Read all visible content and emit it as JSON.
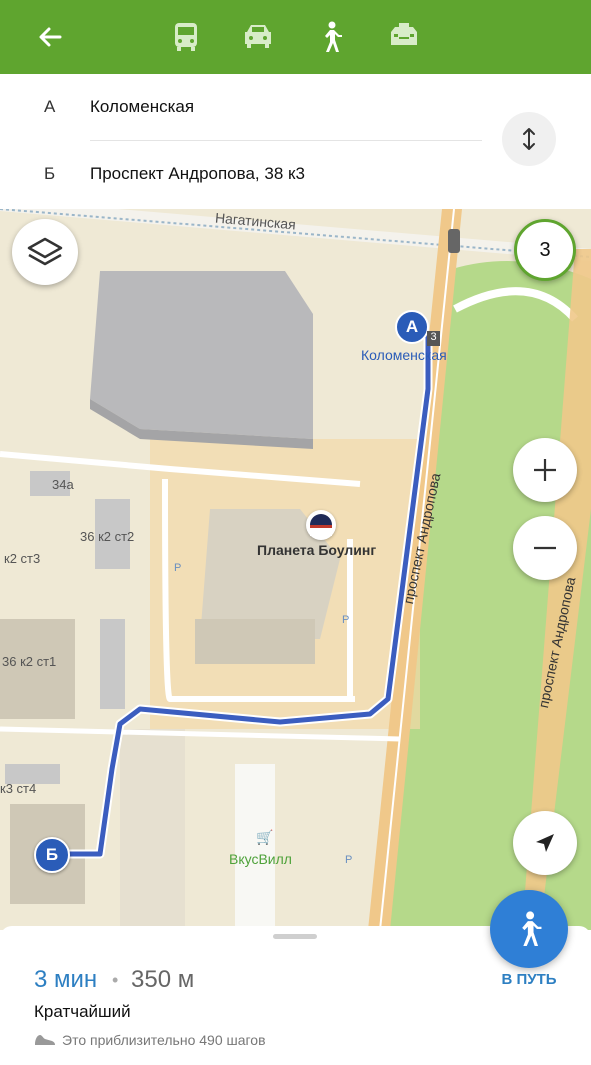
{
  "topbar": {
    "icons": [
      "back-arrow-icon",
      "bus-icon",
      "car-icon",
      "walking-icon",
      "taxi-icon"
    ],
    "color": "#5fa52f"
  },
  "route": {
    "from_letter": "А",
    "from_value": "Коломенская",
    "to_letter": "Б",
    "to_value": "Проспект Андропова, 38 к3"
  },
  "map": {
    "street_top": "Нагатинская",
    "street_top_partial": "Нагатинская",
    "avenue_label": "проспект Андропова",
    "avenue_label_right": "проспект Андропова",
    "station_label": "Коломенская",
    "station_badge": "3",
    "poi_bowling": "Планета Боулинг",
    "poi_shop": "ВкусВилл",
    "bld_34a": "34а",
    "bld_36k2st2": "36 к2 ст2",
    "bld_k2st3": "к2 ст3",
    "bld_36k2st1": "36 к2 ст1",
    "bld_k3st4": "к3 ст4",
    "parking": "P",
    "marker_a": "А",
    "marker_b": "Б",
    "counter": "3",
    "route_color": "#3b5dbf",
    "park_color": "#b5d98a"
  },
  "sheet": {
    "time": "3 мин",
    "separator": "•",
    "distance": "350 м",
    "kind": "Кратчайший",
    "steps": "Это приблизительно 490 шагов",
    "go_label": "В ПУТЬ",
    "accent": "#2d7fc2"
  }
}
